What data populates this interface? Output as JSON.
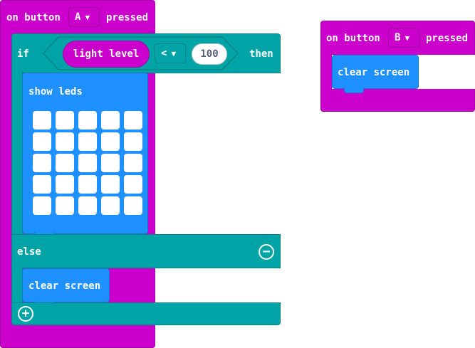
{
  "event_a": {
    "prefix": "on button",
    "button": "A",
    "suffix": "pressed"
  },
  "if_block": {
    "if_label": "if",
    "sensor": "light level",
    "operator": "<",
    "value": "100",
    "then_label": "then",
    "else_label": "else"
  },
  "show_leds": {
    "label": "show leds",
    "leds_on": 0,
    "leds_total": 25
  },
  "clear_screen_label": "clear screen",
  "event_b": {
    "prefix": "on button",
    "button": "B",
    "suffix": "pressed"
  },
  "colors": {
    "event": "#cc00cc",
    "logic": "#00a4a6",
    "basic": "#1e90ff"
  },
  "icons": {
    "dropdown": "caret-down-icon",
    "remove": "minus-circle-icon",
    "add": "plus-circle-icon"
  }
}
